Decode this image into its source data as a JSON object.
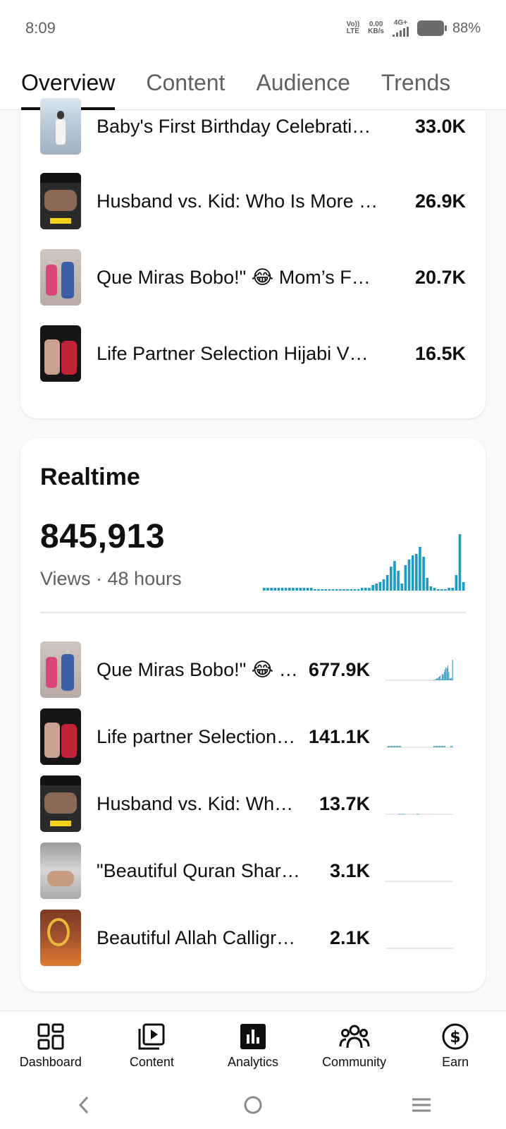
{
  "status": {
    "time": "8:09",
    "volte_top": "Vo))",
    "volte_bottom": "LTE",
    "speed_top": "0.00",
    "speed_bottom": "KB/s",
    "network": "4G+",
    "battery": "88%"
  },
  "tabs": [
    {
      "label": "Overview",
      "active": true
    },
    {
      "label": "Content",
      "active": false
    },
    {
      "label": "Audience",
      "active": false
    },
    {
      "label": "Trends",
      "active": false
    }
  ],
  "top_content": [
    {
      "title": "Baby's First Birthday Celebrati…",
      "value": "33.0K"
    },
    {
      "title": "Husband vs. Kid: Who Is More …",
      "value": "26.9K"
    },
    {
      "title": "Que Miras Bobo!\" 😂 Mom’s F…",
      "value": "20.7K"
    },
    {
      "title": "Life Partner Selection Hijabi V…",
      "value": "16.5K"
    }
  ],
  "realtime": {
    "title": "Realtime",
    "views": "845,913",
    "subtitle": "Views · 48 hours",
    "chart_color": "#1c9bc4",
    "chart_values": [
      2,
      2,
      2,
      2,
      2,
      2,
      2,
      2,
      2,
      2,
      2,
      2,
      2,
      2,
      1,
      1,
      1,
      1,
      1,
      1,
      1,
      1,
      1,
      1,
      1,
      1,
      1,
      2,
      2,
      2,
      4,
      5,
      6,
      8,
      11,
      17,
      21,
      14,
      5,
      18,
      22,
      25,
      26,
      31,
      24,
      9,
      3,
      2,
      1,
      1,
      1,
      2,
      2,
      11,
      40,
      6
    ],
    "items": [
      {
        "title": "Que Miras Bobo!\" 😂 …",
        "value": "677.9K",
        "trend": [
          0,
          0,
          0,
          0,
          0,
          0,
          0,
          0,
          0,
          0,
          0,
          0,
          0,
          0,
          0,
          0,
          0,
          0,
          0,
          0,
          0,
          0,
          0,
          0,
          0,
          0,
          0,
          0,
          0,
          0,
          0,
          0,
          0,
          0,
          0,
          0,
          0,
          0,
          0,
          0,
          0,
          0,
          0,
          0,
          0,
          0,
          0,
          0,
          0,
          0,
          0,
          2,
          3,
          5,
          8,
          10,
          14,
          18,
          22,
          6,
          30,
          28,
          40,
          52,
          64,
          58,
          72,
          40,
          10,
          8,
          12,
          100
        ]
      },
      {
        "title": "Life partner Selection…",
        "value": "141.1K",
        "trend": [
          0,
          0,
          6,
          6,
          6,
          6,
          6,
          6,
          6,
          6,
          6,
          6,
          6,
          6,
          6,
          6,
          6,
          0,
          0,
          0,
          0,
          0,
          0,
          0,
          0,
          0,
          0,
          0,
          0,
          0,
          0,
          0,
          0,
          0,
          0,
          0,
          0,
          0,
          0,
          0,
          0,
          0,
          0,
          0,
          0,
          0,
          0,
          0,
          0,
          0,
          0,
          6,
          6,
          6,
          6,
          6,
          6,
          6,
          6,
          6,
          6,
          6,
          6,
          6,
          0,
          0,
          0,
          0,
          0,
          6,
          6,
          6
        ]
      },
      {
        "title": "Husband vs. Kid: Wh…",
        "value": "13.7K",
        "trend": [
          0,
          0,
          0,
          0,
          0,
          0,
          0,
          0,
          0,
          0,
          0,
          0,
          0,
          0,
          2,
          2,
          2,
          2,
          2,
          2,
          2,
          0,
          0,
          0,
          0,
          0,
          0,
          0,
          0,
          0,
          0,
          0,
          0,
          2,
          2,
          2,
          0,
          0,
          0,
          0,
          0,
          0,
          0,
          0,
          0,
          0,
          0,
          0,
          0,
          0,
          0,
          0,
          0,
          0,
          0,
          0,
          0,
          0,
          0,
          0,
          0,
          0,
          0,
          0,
          0,
          0,
          0,
          0,
          0,
          0,
          0,
          0
        ]
      },
      {
        "title": "\"Beautiful Quran Shar…",
        "value": "3.1K",
        "trend": []
      },
      {
        "title": "Beautiful Allah Calligr…",
        "value": "2.1K",
        "trend": []
      }
    ]
  },
  "bottom_nav": [
    {
      "label": "Dashboard",
      "icon": "dashboard-icon"
    },
    {
      "label": "Content",
      "icon": "content-icon"
    },
    {
      "label": "Analytics",
      "icon": "analytics-icon"
    },
    {
      "label": "Community",
      "icon": "community-icon"
    },
    {
      "label": "Earn",
      "icon": "earn-icon"
    }
  ]
}
